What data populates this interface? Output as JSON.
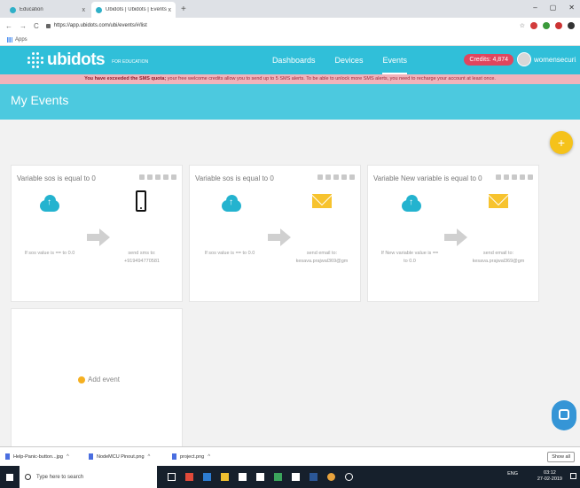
{
  "browser": {
    "tabs": [
      {
        "title": "Education",
        "close": "x"
      },
      {
        "title": "Ubidots | Ubidots | Events",
        "close": "x"
      }
    ],
    "new_tab": "+",
    "window_controls": [
      "–",
      "▢",
      "✕"
    ],
    "nav": [
      "←",
      "→",
      "C"
    ],
    "url": "https://app.ubidots.com/ubi/events/#/list",
    "star": "☆",
    "bookmarks_label": "Apps"
  },
  "header": {
    "logo": "ubidots",
    "logo_sub": "FOR EDUCATION",
    "nav": [
      {
        "label": "Dashboards"
      },
      {
        "label": "Devices"
      },
      {
        "label": "Events"
      }
    ],
    "credits": "Credits: 4,874",
    "username": "womensecuri..."
  },
  "alert": {
    "strong": "You have exceeded the SMS quota;",
    "text": " your free welcome credits allow you to send up to 5 SMS alerts. To be able to unlock more SMS alerts, you need to recharge your account at least once."
  },
  "page": {
    "title": "My Events",
    "fab": "+"
  },
  "events": [
    {
      "title": "Variable sos is equal to 0",
      "trigger": "If sos value is == to 0.0",
      "action_type": "sms",
      "action": "send sms to: +919494770581"
    },
    {
      "title": "Variable sos is equal to 0",
      "trigger": "If sos value is == to 0.0",
      "action_type": "email",
      "action": "send email to: kesava.prajwal369@gm"
    },
    {
      "title": "Variable New variable is equal to 0",
      "trigger": "If New variable value is == to 0.0",
      "action_type": "email",
      "action": "send email to: kesava.prajwal369@gm"
    }
  ],
  "add_event": "Add event",
  "downloads": [
    {
      "name": "Help-Panic-button...jpg"
    },
    {
      "name": "NodeMCU Pinout.png"
    },
    {
      "name": "project.png"
    }
  ],
  "downloads_caret": "^",
  "show_all": "Show all",
  "taskbar": {
    "search_placeholder": "Type here to search",
    "tray": "ENG",
    "time": "03:12",
    "date": "27-02-2019"
  },
  "colors": {
    "header": "#30bfd9",
    "titlebar": "#4cc9df",
    "fab": "#f5c21a",
    "credits": "#e0465e",
    "alert_bg": "#f0b3bb",
    "cloud": "#24b3cf",
    "mail": "#f7c32e"
  }
}
